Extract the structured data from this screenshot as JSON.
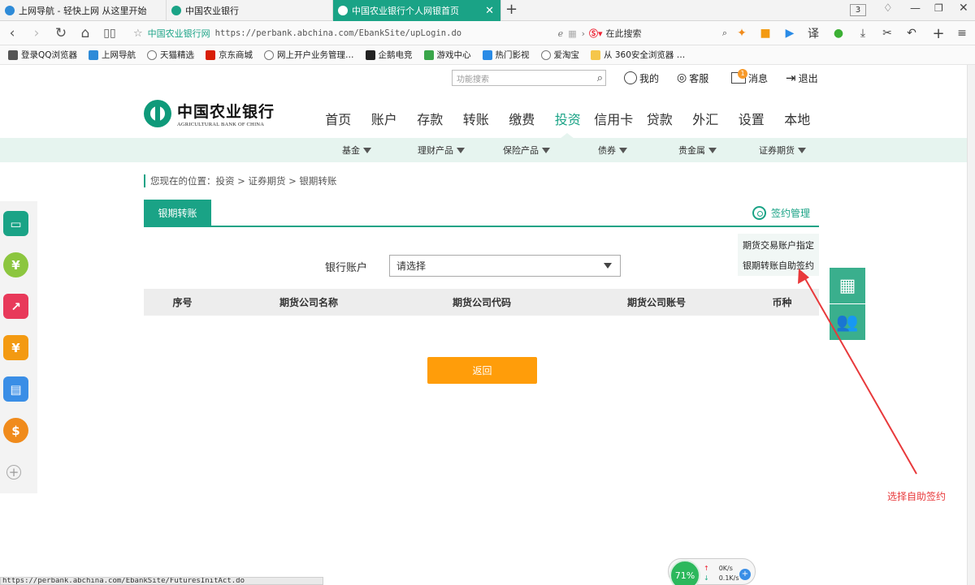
{
  "browser": {
    "tabs": [
      {
        "title": "上网导航 - 轻快上网 从这里开始",
        "active": false
      },
      {
        "title": "中国农业银行",
        "active": false
      },
      {
        "title": "中国农业银行个人网银首页",
        "active": true
      }
    ],
    "tab_count": "3",
    "address": {
      "site_label": "中国农业银行网",
      "url": "https://perbank.abchina.com/EbankSite/upLogin.do"
    },
    "search_placeholder": "在此搜索",
    "translate_label": "译",
    "bookmarks": [
      "登录QQ浏览器",
      "上网导航",
      "天猫精选",
      "京东商城",
      "网上开户业务管理…",
      "企鹅电竞",
      "游戏中心",
      "热门影视",
      "爱淘宝",
      "从 360安全浏览器 …"
    ],
    "status_url": "https://perbank.abchina.com/EbankSite/FuturesInitAct.do"
  },
  "header": {
    "search_placeholder": "功能搜索",
    "links": {
      "mine": "我的",
      "service": "客服",
      "messages": "消息",
      "logout": "退出"
    },
    "message_badge": "1",
    "logo_cn": "中国农业银行",
    "logo_en": "AGRICULTURAL BANK OF CHINA"
  },
  "main_nav": [
    "首页",
    "账户",
    "存款",
    "转账",
    "缴费",
    "投资",
    "信用卡",
    "贷款",
    "外汇",
    "设置",
    "本地"
  ],
  "active_nav": "投资",
  "sub_nav": [
    "基金",
    "理财产品",
    "保险产品",
    "债券",
    "贵金属",
    "证券期货"
  ],
  "breadcrumb": "您现在的位置：投资 > 证券期货 > 银期转账",
  "tab": {
    "label": "银期转账"
  },
  "sign_management": {
    "label": "签约管理",
    "menu": [
      "期货交易账户指定",
      "银期转账自助签约"
    ]
  },
  "form": {
    "account_label": "银行账户",
    "account_value": "请选择"
  },
  "table": {
    "columns": [
      "序号",
      "期货公司名称",
      "期货公司代码",
      "期货公司账号",
      "币种"
    ]
  },
  "back_button": "返回",
  "annotation": "选择自助签约",
  "speed": {
    "percent": "71%",
    "up": "0K/s",
    "down": "0.1K/s"
  },
  "colors": {
    "accent": "#1aa386",
    "button": "#ff9d0a",
    "annotation": "#e8393b"
  }
}
